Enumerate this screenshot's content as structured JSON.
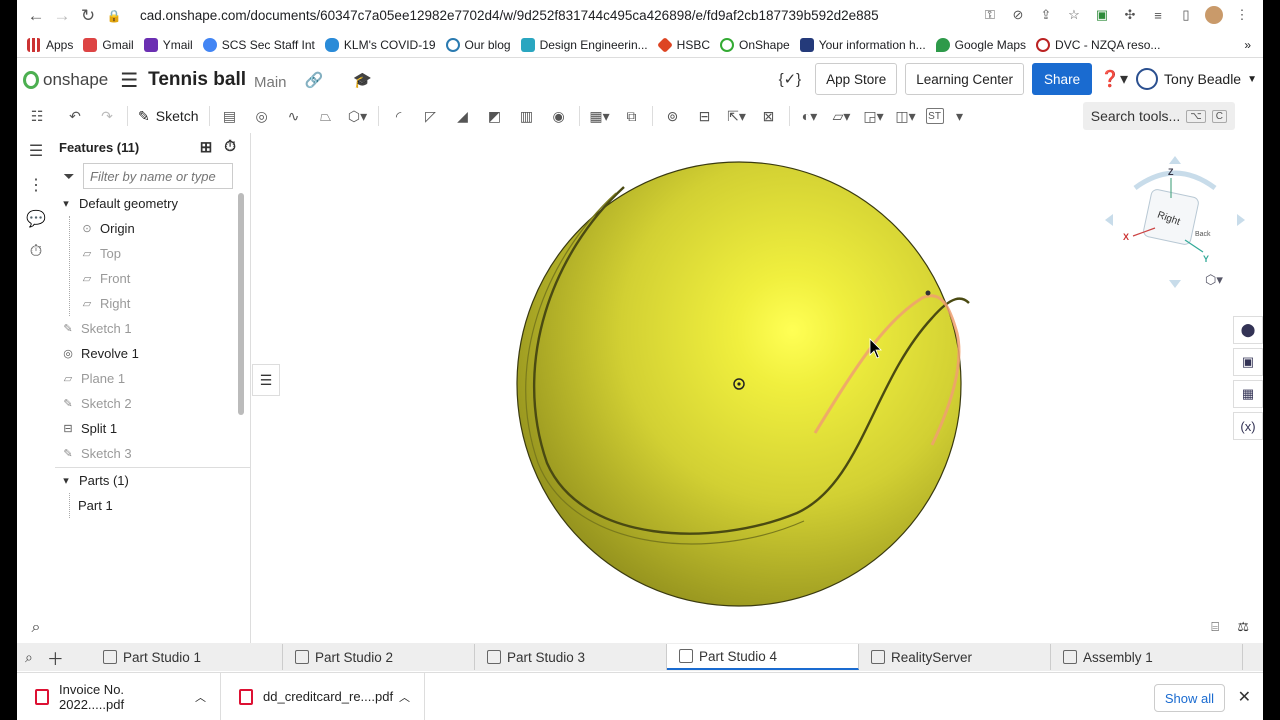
{
  "browser": {
    "url": "cad.onshape.com/documents/60347c7a05ee12982e7702d4/w/9d252f831744c495ca426898/e/fd9af2cb187739b592d2e885",
    "bookmarks": [
      "Apps",
      "Gmail",
      "Ymail",
      "SCS Sec Staff Int",
      "KLM's COVID-19",
      "Our blog",
      "Design Engineerin...",
      "HSBC",
      "OnShape",
      "Your information h...",
      "Google Maps",
      "DVC - NZQA reso..."
    ]
  },
  "header": {
    "logo": "onshape",
    "doc_title": "Tennis ball",
    "branch": "Main",
    "app_store": "App Store",
    "learning_center": "Learning Center",
    "share": "Share",
    "user": "Tony Beadle"
  },
  "toolbar": {
    "sketch_label": "Sketch",
    "search_label": "Search tools...",
    "shortcut_a": "⌥",
    "shortcut_b": "C",
    "st_label": "ST"
  },
  "features": {
    "title": "Features (11)",
    "filter_placeholder": "Filter by name or type",
    "default_geometry": "Default geometry",
    "items": [
      {
        "label": "Origin",
        "dim": false,
        "icon": "origin-icon"
      },
      {
        "label": "Top",
        "dim": true,
        "icon": "plane-icon"
      },
      {
        "label": "Front",
        "dim": true,
        "icon": "plane-icon"
      },
      {
        "label": "Right",
        "dim": true,
        "icon": "plane-icon"
      },
      {
        "label": "Sketch 1",
        "dim": true,
        "icon": "sketch-icon"
      },
      {
        "label": "Revolve 1",
        "dim": false,
        "icon": "revolve-icon"
      },
      {
        "label": "Plane 1",
        "dim": true,
        "icon": "plane-icon"
      },
      {
        "label": "Sketch 2",
        "dim": true,
        "icon": "sketch-icon"
      },
      {
        "label": "Split 1",
        "dim": false,
        "icon": "split-icon"
      },
      {
        "label": "Sketch 3",
        "dim": true,
        "icon": "sketch-icon"
      }
    ],
    "parts_title": "Parts (1)",
    "part": "Part 1"
  },
  "viewcube": {
    "z": "Z",
    "x": "X",
    "y": "Y",
    "face": "Right",
    "back": "Back"
  },
  "tabs": [
    {
      "label": "Part Studio 1",
      "active": false
    },
    {
      "label": "Part Studio 2",
      "active": false
    },
    {
      "label": "Part Studio 3",
      "active": false
    },
    {
      "label": "Part Studio 4",
      "active": true
    },
    {
      "label": "RealityServer",
      "active": false
    },
    {
      "label": "Assembly 1",
      "active": false
    }
  ],
  "downloads": {
    "file1": "Invoice No. 2022.....pdf",
    "file2": "dd_creditcard_re....pdf",
    "show_all": "Show all"
  },
  "colors": {
    "ball": "#dede3c",
    "seam_highlight": "#f0a070",
    "accent": "#1a6bd0"
  }
}
